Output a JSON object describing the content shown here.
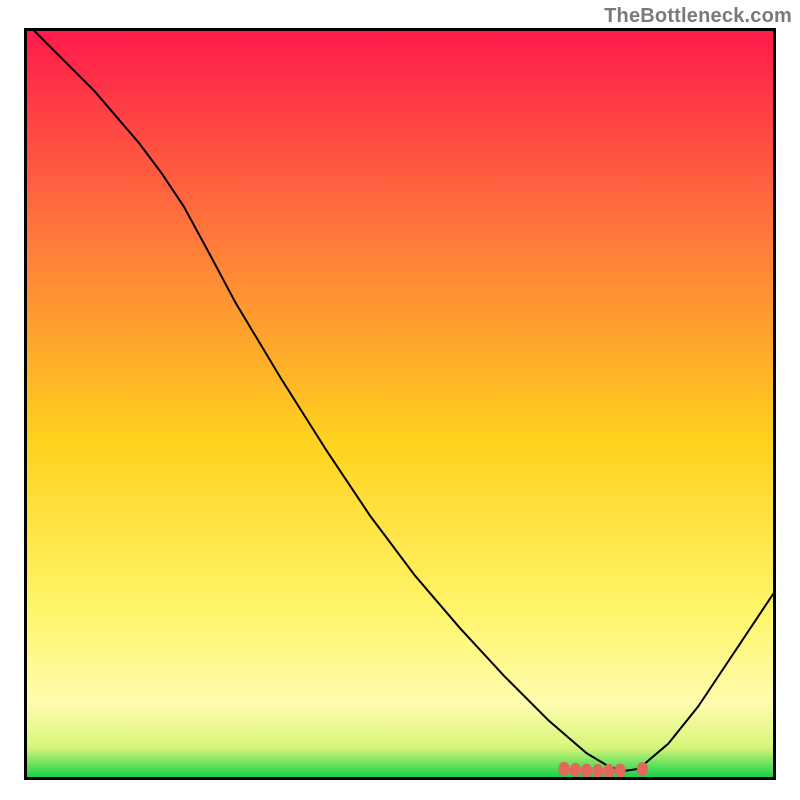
{
  "watermark": "TheBottleneck.com",
  "chart_data": {
    "type": "line",
    "title": "",
    "xlabel": "",
    "ylabel": "",
    "xlim": [
      0,
      100
    ],
    "ylim": [
      0,
      100
    ],
    "grid": false,
    "gradient": {
      "top": "#ff1a4b",
      "mid_upper": "#ff7a3a",
      "mid": "#ffd21e",
      "mid_lower": "#fff66b",
      "valley_band": "#fffcae",
      "bottom": "#17d24a"
    },
    "series": [
      {
        "name": "bottleneck-curve",
        "color": "#000000",
        "x": [
          0,
          3,
          6,
          9,
          12,
          15,
          18,
          21,
          24,
          28,
          34,
          40,
          46,
          52,
          58,
          64,
          70,
          75,
          78,
          80,
          82,
          86,
          90,
          94,
          100
        ],
        "y": [
          101,
          98,
          95,
          92,
          88.5,
          85,
          81,
          76.5,
          71,
          63.5,
          53.5,
          44,
          35,
          27,
          20,
          13.5,
          7.5,
          3.2,
          1.4,
          0.8,
          1.1,
          4.5,
          9.5,
          15.5,
          24.5
        ]
      }
    ],
    "markers": {
      "name": "optimal-points",
      "color": "#e2685c",
      "points": [
        {
          "x": 72.0,
          "y": 1.1
        },
        {
          "x": 73.5,
          "y": 0.95
        },
        {
          "x": 75.0,
          "y": 0.85
        },
        {
          "x": 76.5,
          "y": 0.8
        },
        {
          "x": 78.0,
          "y": 0.8
        },
        {
          "x": 79.5,
          "y": 0.85
        },
        {
          "x": 82.5,
          "y": 1.05
        }
      ]
    }
  }
}
